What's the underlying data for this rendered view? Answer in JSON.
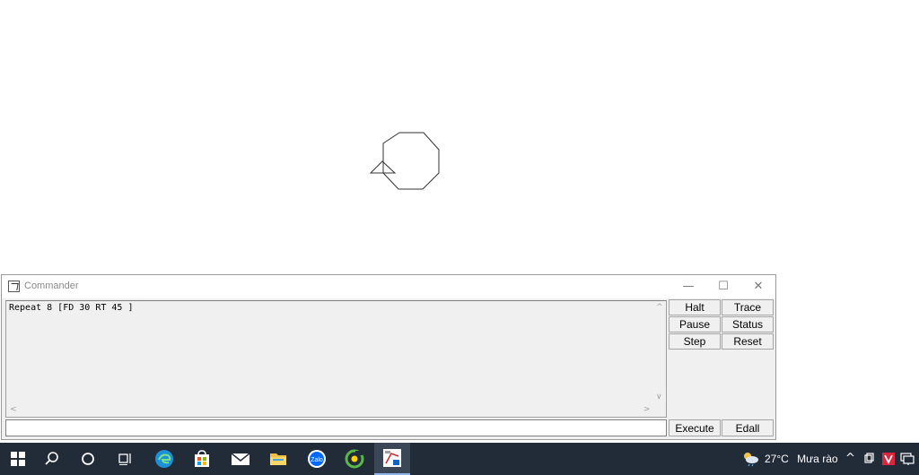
{
  "commander": {
    "title": "Commander",
    "output_text": "Repeat 8 [FD 30 RT 45 ]",
    "input_value": "",
    "buttons": {
      "halt": "Halt",
      "trace": "Trace",
      "pause": "Pause",
      "status": "Status",
      "step": "Step",
      "reset": "Reset",
      "execute": "Execute",
      "edall": "Edall"
    }
  },
  "taskbar": {
    "pinned_icons": [
      "windows-start-icon",
      "search-icon",
      "cortana-icon",
      "task-view-icon",
      "edge-icon",
      "store-icon",
      "mail-icon",
      "file-explorer-icon",
      "zalo-icon",
      "coccoc-icon",
      "logo-app-icon"
    ],
    "zalo_label": "Zalo",
    "weather": {
      "temperature": "27°C",
      "condition": "Mưa rào"
    },
    "tray_icons": [
      "chevron-up-icon",
      "meet-icon",
      "antivirus-icon",
      "network-icon"
    ]
  },
  "colors": {
    "taskbar_bg": "#222b38",
    "window_bg": "#f0f0f0",
    "edge_blue": "#1e90d6",
    "zalo_blue": "#0068ff",
    "coccoc_green": "#58b947",
    "antivirus_red": "#d7263d"
  }
}
